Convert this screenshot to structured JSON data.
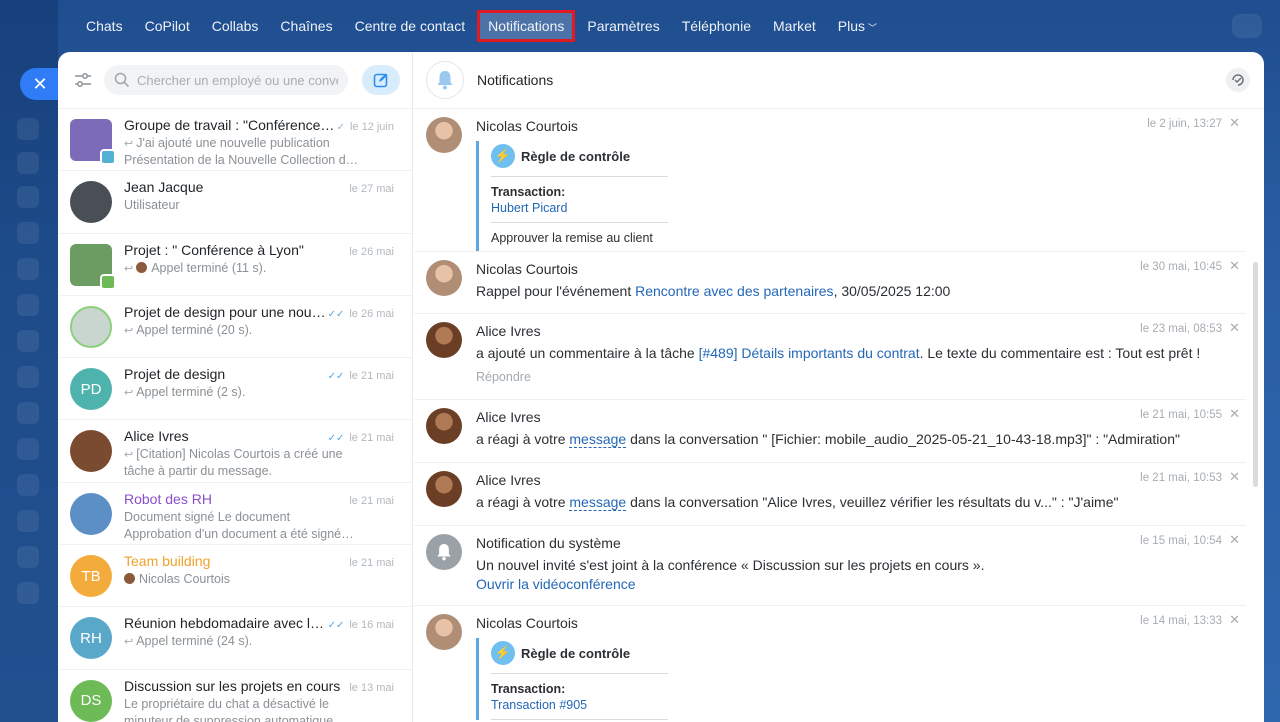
{
  "nav": {
    "items": [
      "Chats",
      "CoPilot",
      "Collabs",
      "Chaînes",
      "Centre de contact",
      "Notifications",
      "Paramètres",
      "Téléphonie",
      "Market",
      "Plus"
    ],
    "active": "Notifications"
  },
  "sidebar": {
    "search_placeholder": "Chercher un employé ou une conve",
    "chats": [
      {
        "name": "Groupe de travail : \"Conférence…",
        "date": "le 12 juin",
        "line1": "J'ai ajouté une nouvelle publication",
        "line2": "Présentation de la Nouvelle Collection d…",
        "avatar_color": "#7b6bb8"
      },
      {
        "name": "Jean Jacque",
        "date": "le 27 mai",
        "line1": "Utilisateur",
        "avatar_color": "#4a4f56"
      },
      {
        "name": "Projet : \" Conférence à Lyon\"",
        "date": "le 26 mai",
        "line1": "Appel terminé (11 s).",
        "avatar_color": "#6b9c62"
      },
      {
        "name": "Projet de design pour une nou…",
        "date": "le 26 mai",
        "line1": "Appel terminé (20 s).",
        "avatar_color": "#c9d6cf"
      },
      {
        "name": "Projet de design",
        "date": "le 21 mai",
        "line1": "Appel terminé (2 s).",
        "initials": "PD",
        "avatar_color": "#4fb3ad"
      },
      {
        "name": "Alice Ivres",
        "date": "le 21 mai",
        "line1": "[Citation] Nicolas Courtois a créé une",
        "line2": "tâche à partir du message.",
        "avatar_color": "#7a4b30"
      },
      {
        "name": "Robot des RH",
        "date": "le 21 mai",
        "line1": "Document signé Le document",
        "line2": "Approbation d'un document a été signé…",
        "avatar_color": "#5d8fc7"
      },
      {
        "name": "Team building",
        "date": "le 21 mai",
        "line1": "Nicolas Courtois",
        "initials": "TB",
        "avatar_color": "#f3ac3b"
      },
      {
        "name": "Réunion hebdomadaire avec le…",
        "date": "le 16 mai",
        "line1": "Appel terminé (24 s).",
        "initials": "RH",
        "avatar_color": "#5aa8c9"
      },
      {
        "name": "Discussion sur les projets en cours",
        "date": "le 13 mai",
        "line1": "Le propriétaire du chat a désactivé le",
        "line2": "minuteur de suppression automatique",
        "initials": "DS",
        "avatar_color": "#6dba56"
      }
    ]
  },
  "panel": {
    "title": "Notifications",
    "notifications": [
      {
        "author": "Nicolas Courtois",
        "date": "le 2 juin, 13:27",
        "type": "block",
        "block_title": "Règle de contrôle",
        "block_label": "Transaction:",
        "block_link": "Hubert Picard",
        "block_foot": "Approuver la remise au client"
      },
      {
        "author": "Nicolas Courtois",
        "date": "le 30 mai, 10:45",
        "text_pre": "Rappel pour l'événement ",
        "text_link": "Rencontre avec des partenaires",
        "text_post": ", 30/05/2025 12:00"
      },
      {
        "author": "Alice Ivres",
        "date": "le 23 mai, 08:53",
        "text_pre": "a ajouté un commentaire à la tâche ",
        "text_link": "[#489] Détails importants du contrat",
        "text_post": ". Le texte du commentaire est : Tout est prêt !",
        "reply": "Répondre"
      },
      {
        "author": "Alice Ivres",
        "date": "le 21 mai, 10:55",
        "text_pre": "a réagi à votre ",
        "text_link": "message",
        "text_post": " dans la conversation \" [Fichier: mobile_audio_2025-05-21_10-43-18.mp3]\" : \"Admiration\""
      },
      {
        "author": "Alice Ivres",
        "date": "le 21 mai, 10:53",
        "text_pre": "a réagi à votre ",
        "text_link": "message",
        "text_post": " dans la conversation \"Alice Ivres, veuillez vérifier les résultats du v...\" : \"J'aime\""
      },
      {
        "author": "Notification du système",
        "date": "le 15 mai, 10:54",
        "text_pre": "Un nouvel invité s'est joint à la conférence « Discussion sur les projets en cours ».",
        "link_line": "Ouvrir la vidéoconférence"
      },
      {
        "author": "Nicolas Courtois",
        "date": "le 14 mai, 13:33",
        "type": "block",
        "block_title": "Règle de contrôle",
        "block_label": "Transaction:",
        "block_link": "Transaction #905"
      }
    ]
  },
  "colors": {
    "accent": "#2f7cf6",
    "link": "#2467b8",
    "highlight_border": "#e01a22"
  }
}
